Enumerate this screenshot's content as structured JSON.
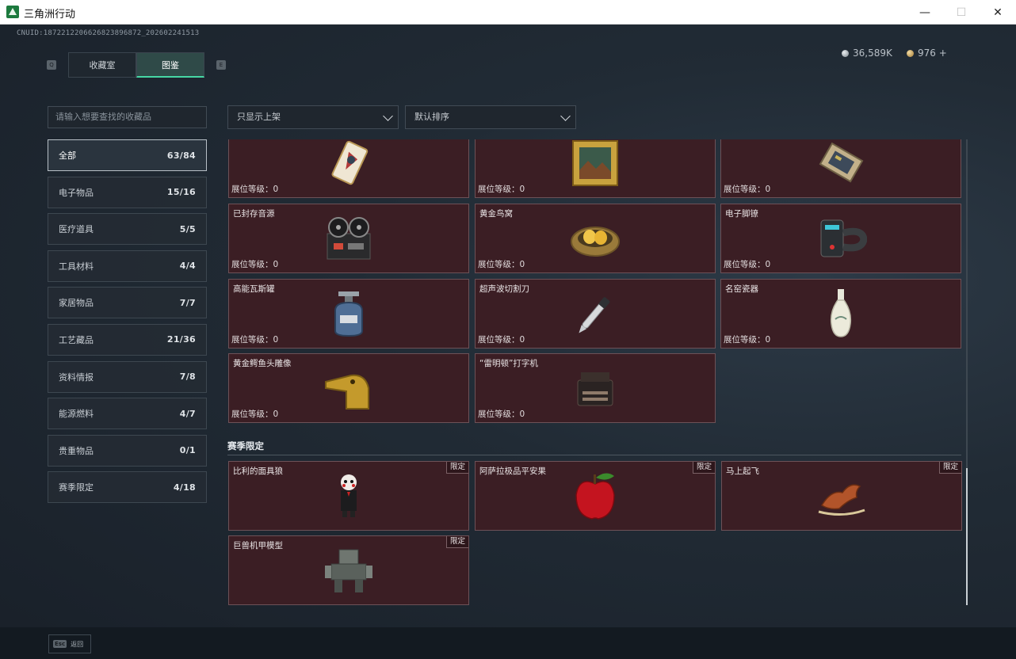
{
  "window": {
    "title": "三角洲行动",
    "min_glyph": "—",
    "max_glyph": "☐",
    "close_glyph": "✕"
  },
  "header": {
    "uid": "CNUID:1872212206626823896872_202602241513",
    "silver": "36,589K",
    "gold": "976 +",
    "tab_key_left": "Q",
    "tab_key_right": "E"
  },
  "tabs": [
    {
      "label": "收藏室",
      "active": false
    },
    {
      "label": "图鉴",
      "active": true
    }
  ],
  "search": {
    "placeholder": "请输入想要查找的收藏品"
  },
  "filters": {
    "shelf": "只显示上架",
    "sort": "默认排序"
  },
  "sidebar": {
    "items": [
      {
        "label": "全部",
        "count": "63/84",
        "active": true
      },
      {
        "label": "电子物品",
        "count": "15/16"
      },
      {
        "label": "医疗道具",
        "count": "5/5"
      },
      {
        "label": "工具材料",
        "count": "4/4"
      },
      {
        "label": "家居物品",
        "count": "7/7"
      },
      {
        "label": "工艺藏品",
        "count": "21/36"
      },
      {
        "label": "资料情报",
        "count": "7/8"
      },
      {
        "label": "能源燃料",
        "count": "4/7"
      },
      {
        "label": "贵重物品",
        "count": "0/1"
      },
      {
        "label": "赛季限定",
        "count": "4/18"
      }
    ]
  },
  "level_label": "展位等级：",
  "items": [
    {
      "name": "",
      "level": "0",
      "icon": "tarot-card-icon"
    },
    {
      "name": "",
      "level": "0",
      "icon": "framed-painting-icon"
    },
    {
      "name": "",
      "level": "0",
      "icon": "circuit-device-icon"
    },
    {
      "name": "已封存音源",
      "level": "0",
      "icon": "reel-recorder-icon"
    },
    {
      "name": "黄金鸟窝",
      "level": "0",
      "icon": "golden-nest-icon"
    },
    {
      "name": "电子脚镣",
      "level": "0",
      "icon": "ankle-monitor-icon"
    },
    {
      "name": "高能瓦斯罐",
      "level": "0",
      "icon": "gas-canister-icon"
    },
    {
      "name": "超声波切割刀",
      "level": "0",
      "icon": "cutter-knife-icon"
    },
    {
      "name": "名窑瓷器",
      "level": "0",
      "icon": "porcelain-vase-icon"
    },
    {
      "name": "黄金鳄鱼头雕像",
      "level": "0",
      "icon": "gold-crocodile-icon"
    },
    {
      "name": "“雷明顿”打字机",
      "level": "0",
      "icon": "typewriter-icon"
    }
  ],
  "season_section": {
    "title": "赛季限定",
    "tag": "限定",
    "items": [
      {
        "name": "比利的面具狼",
        "icon": "puppet-doll-icon"
      },
      {
        "name": "阿萨拉极品平安果",
        "icon": "red-apple-icon"
      },
      {
        "name": "马上起飞",
        "icon": "flying-horse-icon"
      },
      {
        "name": "巨兽机甲模型",
        "icon": "mecha-model-icon"
      }
    ]
  },
  "footer": {
    "esc_key": "Esc",
    "esc_label": "返回"
  }
}
